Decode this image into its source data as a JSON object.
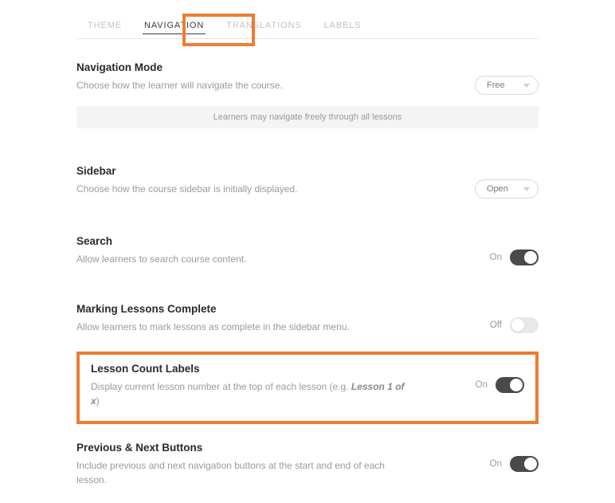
{
  "tabs": {
    "theme": "THEME",
    "navigation": "NAVIGATION",
    "translations": "TRANSLATIONS",
    "labels": "LABELS"
  },
  "navMode": {
    "title": "Navigation Mode",
    "desc": "Choose how the learner will navigate the course.",
    "selected": "Free",
    "infoBar": "Learners may navigate freely through all lessons"
  },
  "sidebar": {
    "title": "Sidebar",
    "desc": "Choose how the course sidebar is initially displayed.",
    "selected": "Open"
  },
  "search": {
    "title": "Search",
    "desc": "Allow learners to search course content.",
    "stateLabel": "On"
  },
  "markingComplete": {
    "title": "Marking Lessons Complete",
    "desc": "Allow learners to mark lessons as complete in the sidebar menu.",
    "stateLabel": "Off"
  },
  "lessonCount": {
    "title": "Lesson Count Labels",
    "descPrefix": "Display current lesson number at the top of each lesson (e.g. ",
    "descEmph": "Lesson 1 of x",
    "descSuffix": ")",
    "stateLabel": "On"
  },
  "prevNext": {
    "title": "Previous & Next Buttons",
    "desc": "Include previous and next navigation buttons at the start and end of each lesson.",
    "stateLabel": "On"
  }
}
